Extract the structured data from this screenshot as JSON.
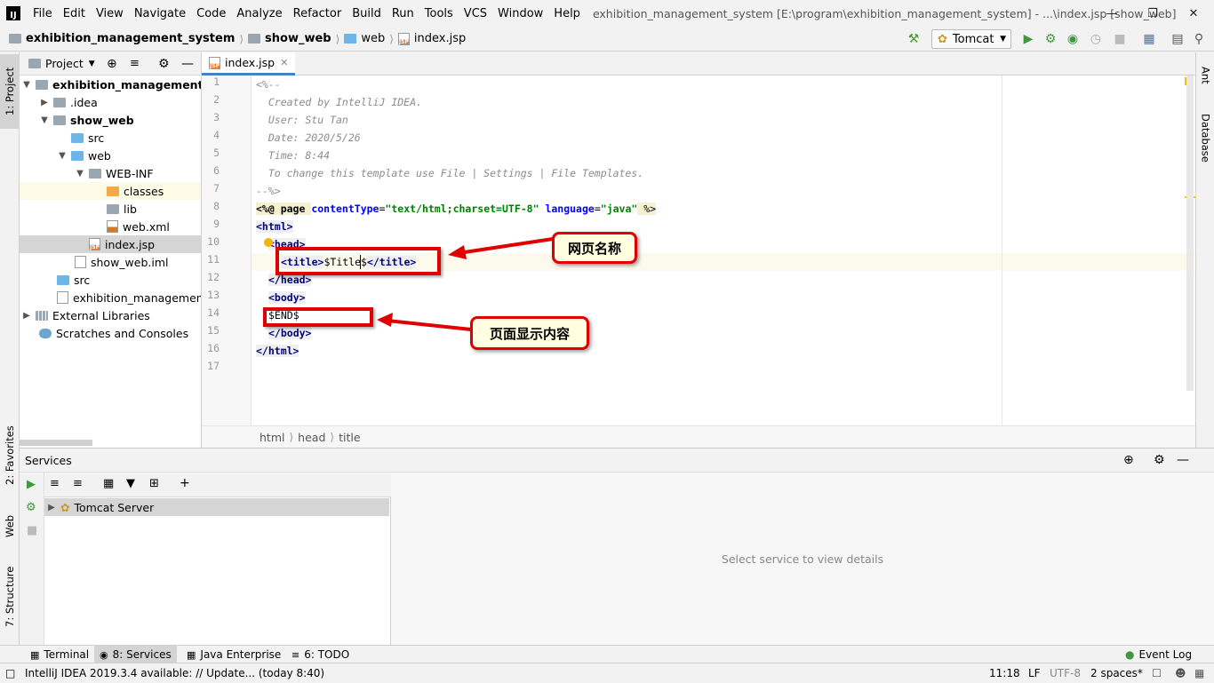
{
  "menubar": {
    "logo": "IJ",
    "items": [
      "File",
      "Edit",
      "View",
      "Navigate",
      "Code",
      "Analyze",
      "Refactor",
      "Build",
      "Run",
      "Tools",
      "VCS",
      "Window",
      "Help"
    ],
    "window_title": "exhibition_management_system [E:\\program\\exhibition_management_system] - ...\\index.jsp [show_web]"
  },
  "navbar": {
    "crumbs": [
      "exhibition_management_system",
      "show_web",
      "web",
      "index.jsp"
    ],
    "run_config": "Tomcat"
  },
  "leftstrip": {
    "tabs": [
      "1: Project",
      "2: Favorites",
      "Web",
      "7: Structure"
    ]
  },
  "rightstrip": {
    "tabs": [
      "Ant",
      "Database"
    ]
  },
  "project": {
    "title": "Project",
    "tree": [
      {
        "label": "exhibition_management_sy",
        "bold": true
      },
      {
        "label": ".idea"
      },
      {
        "label": "show_web",
        "bold": true
      },
      {
        "label": "src"
      },
      {
        "label": "web"
      },
      {
        "label": "WEB-INF"
      },
      {
        "label": "classes"
      },
      {
        "label": "lib"
      },
      {
        "label": "web.xml"
      },
      {
        "label": "index.jsp"
      },
      {
        "label": "show_web.iml"
      },
      {
        "label": "src"
      },
      {
        "label": "exhibition_management_s"
      },
      {
        "label": "External Libraries"
      },
      {
        "label": "Scratches and Consoles"
      }
    ]
  },
  "editor": {
    "tab": "index.jsp",
    "lines": [
      "1",
      "2",
      "3",
      "4",
      "5",
      "6",
      "7",
      "8",
      "9",
      "10",
      "11",
      "12",
      "13",
      "14",
      "15",
      "16",
      "17"
    ],
    "code": {
      "l1": "<%--",
      "l2": "  Created by IntelliJ IDEA.",
      "l3": "  User: Stu Tan",
      "l4": "  Date: 2020/5/26",
      "l5": "  Time: 8:44",
      "l6": "  To change this template use File | Settings | File Templates.",
      "l7": "--%>",
      "l8_a": "<%@ page ",
      "l8_b": "contentType",
      "l8_c": "=",
      "l8_d": "\"text/html;charset=UTF-8\"",
      "l8_e": " language",
      "l8_f": "=",
      "l8_g": "\"java\"",
      "l8_h": " %>",
      "l9": "<html>",
      "l10": "<head>",
      "l11_a": "<title>",
      "l11_b": "$Title$",
      "l11_c": "</title>",
      "l12": "</head>",
      "l13": "<body>",
      "l14": "$END$",
      "l15": "</body>",
      "l16": "</html>"
    },
    "crumbs": [
      "html",
      "head",
      "title"
    ]
  },
  "annotations": {
    "title_callout": "网页名称",
    "body_callout": "页面显示内容"
  },
  "services": {
    "title": "Services",
    "tree_item": "Tomcat Server",
    "detail_placeholder": "Select service to view details"
  },
  "toolwindows": [
    "Terminal",
    "8: Services",
    "Java Enterprise",
    "6: TODO"
  ],
  "event_log": "Event Log",
  "status": {
    "message": "IntelliJ IDEA 2019.3.4 available: // Update... (today 8:40)",
    "position": "11:18",
    "line_sep": "LF",
    "encoding": "UTF-8",
    "indent": "2 spaces*"
  },
  "colors": {
    "accent": "#4083c9",
    "annotation_red": "#e00000",
    "callout_bg": "#fffee0"
  }
}
